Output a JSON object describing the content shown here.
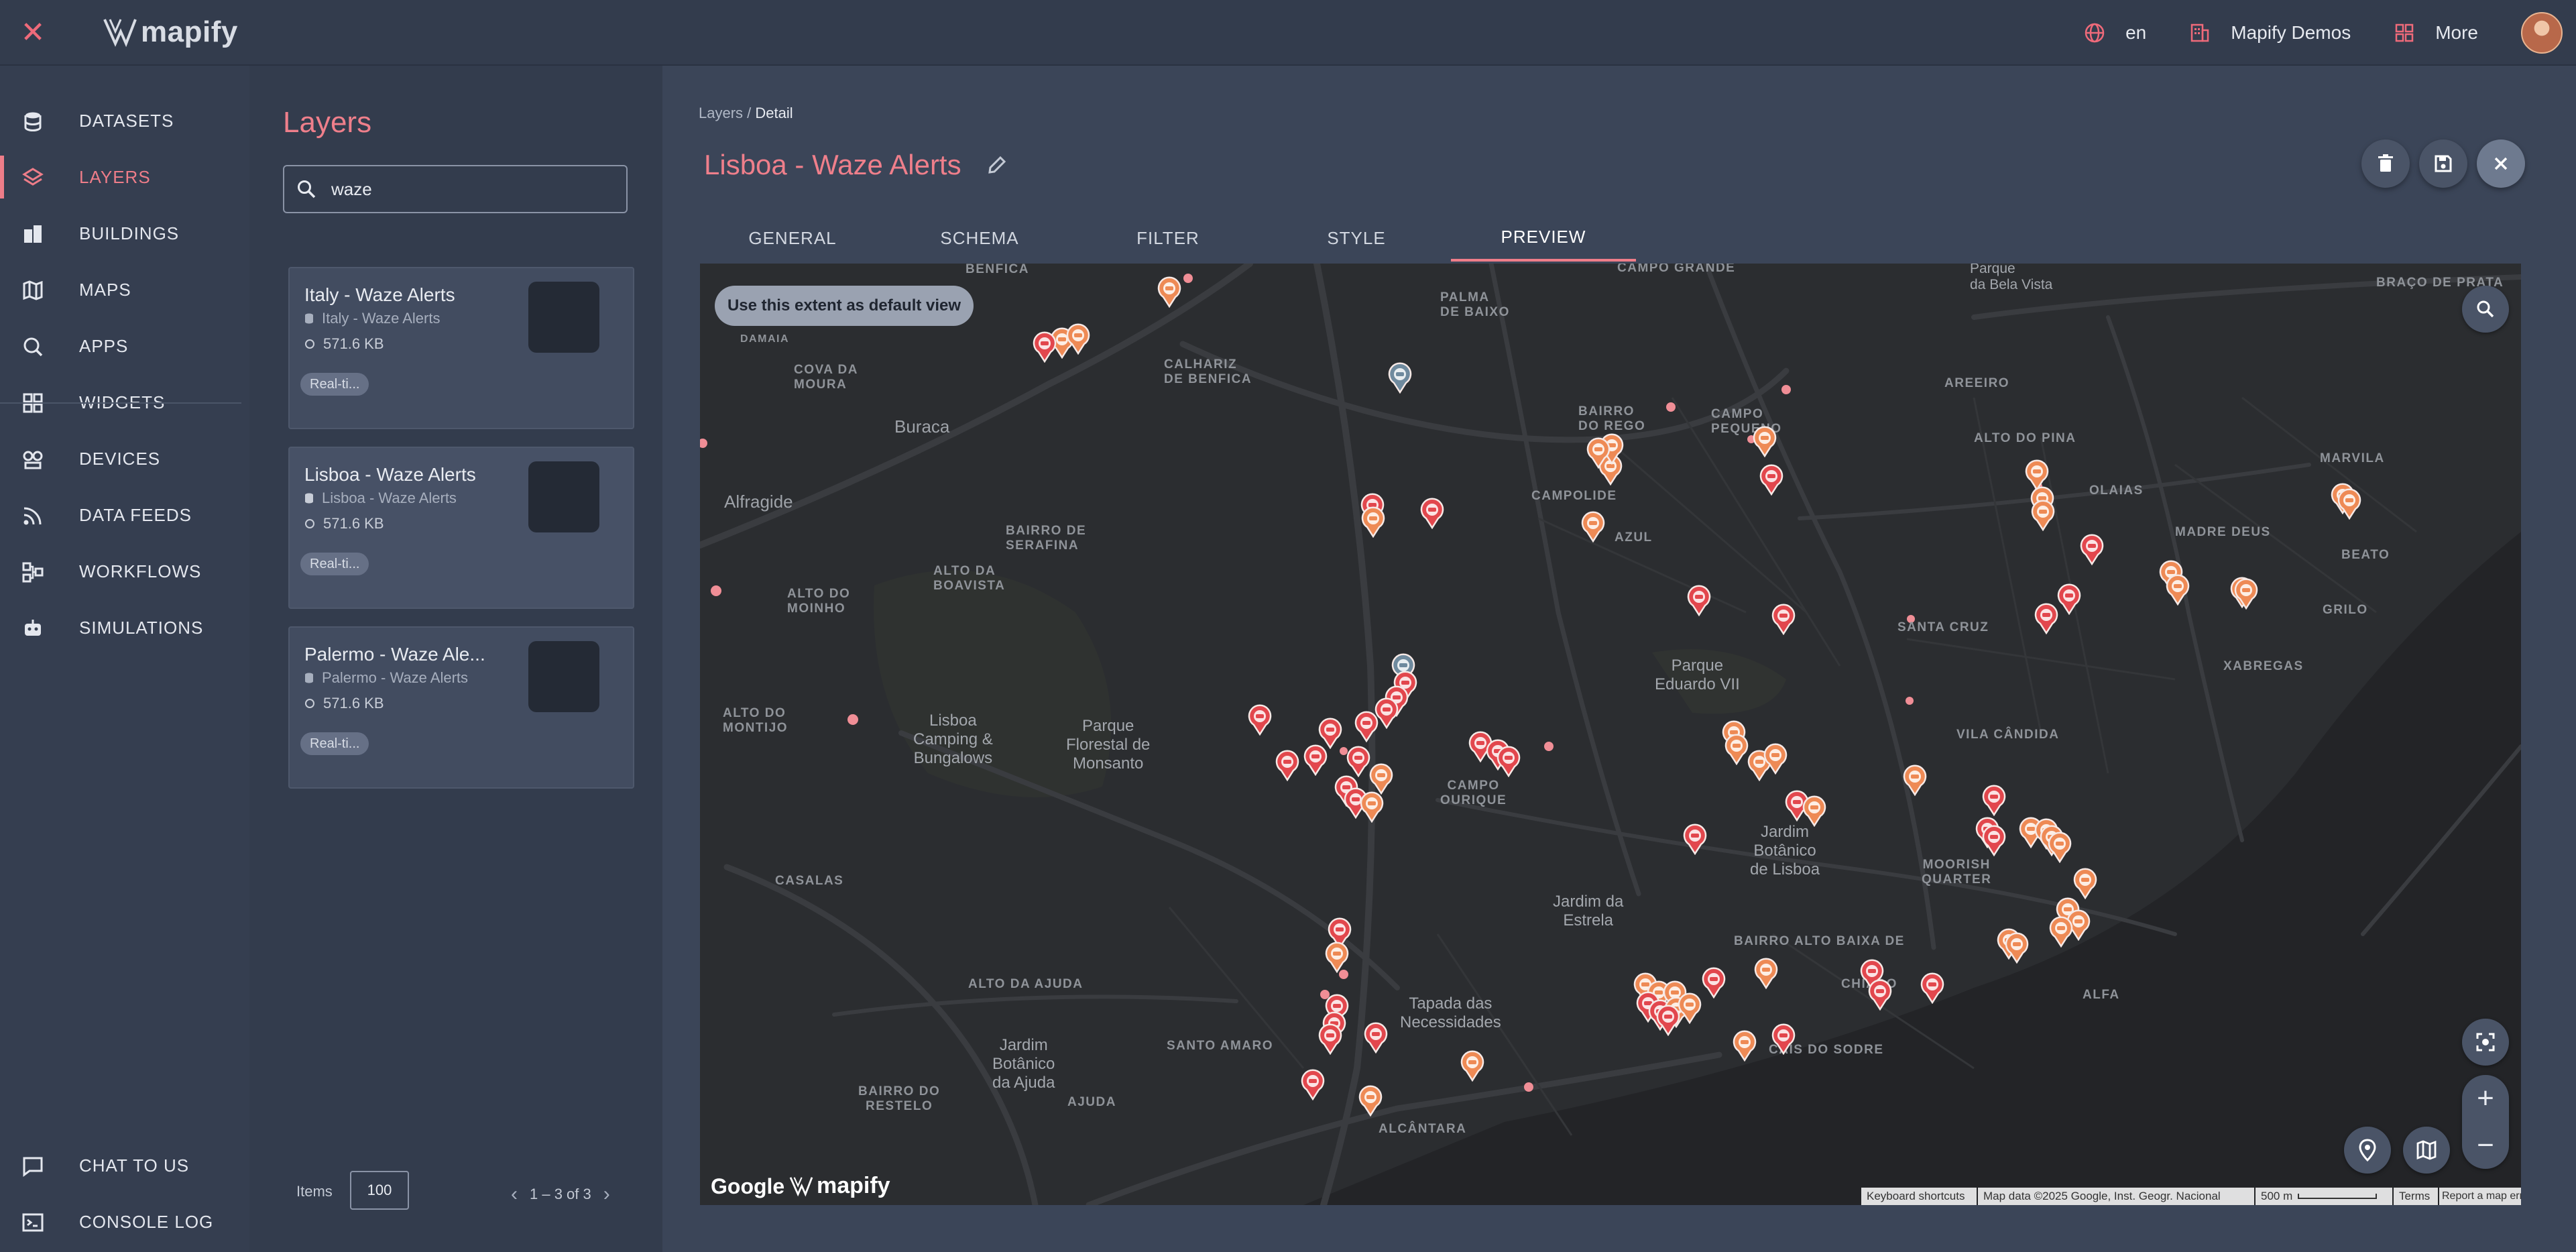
{
  "brand": {
    "name": "mapify"
  },
  "topbar": {
    "language": "en",
    "org": "Mapify Demos",
    "more": "More"
  },
  "nav": {
    "items": [
      {
        "label": "DATASETS",
        "icon": "database-icon"
      },
      {
        "label": "LAYERS",
        "icon": "layers-icon",
        "active": true
      },
      {
        "label": "BUILDINGS",
        "icon": "buildings-icon"
      },
      {
        "label": "MAPS",
        "icon": "map-icon"
      },
      {
        "label": "APPS",
        "icon": "apps-search-icon"
      },
      {
        "label": "WIDGETS",
        "icon": "widgets-icon"
      },
      {
        "label": "DEVICES",
        "icon": "devices-icon"
      },
      {
        "label": "DATA FEEDS",
        "icon": "rss-feed-icon"
      },
      {
        "label": "WORKFLOWS",
        "icon": "workflow-icon"
      },
      {
        "label": "SIMULATIONS",
        "icon": "robot-icon"
      }
    ],
    "bottom": [
      {
        "label": "CHAT TO US",
        "icon": "chat-icon"
      },
      {
        "label": "CONSOLE LOG",
        "icon": "console-icon"
      }
    ]
  },
  "layers": {
    "title": "Layers",
    "search_value": "waze",
    "cards": [
      {
        "title": "Italy - Waze Alerts",
        "dataset": "Italy - Waze Alerts",
        "size": "571.6 KB",
        "badge": "Real-ti..."
      },
      {
        "title": "Lisboa - Waze Alerts",
        "dataset": "Lisboa - Waze Alerts",
        "size": "571.6 KB",
        "badge": "Real-ti..."
      },
      {
        "title": "Palermo - Waze Ale...",
        "dataset": "Palermo - Waze Alerts",
        "size": "571.6 KB",
        "badge": "Real-ti..."
      }
    ],
    "items_label": "Items",
    "items_value": "100",
    "pager": "1 – 3 of 3"
  },
  "detail": {
    "breadcrumb_root": "Layers",
    "breadcrumb_sep": " / ",
    "breadcrumb_current": "Detail",
    "title": "Lisboa - Waze Alerts",
    "tabs": [
      "GENERAL",
      "SCHEMA",
      "FILTER",
      "STYLE",
      "PREVIEW"
    ],
    "active_tab": "PREVIEW"
  },
  "map": {
    "extent_button": "Use this extent as default view",
    "google": "Google",
    "brand": "mapify",
    "attribution": {
      "shortcuts": "Keyboard shortcuts",
      "data": "Map data ©2025 Google, Inst. Geogr. Nacional",
      "scale": "500 m",
      "terms": "Terms",
      "report": "Report a map error"
    },
    "labels": {
      "benfica": "BENFICA",
      "damaia": "DAMAIA",
      "cova_da_moura": "COVA DA\nMOURA",
      "calhariz": "CALHARIZ\nDE BENFICA",
      "buraca": "Buraca",
      "alfragide": "Alfragide",
      "palma": "PALMA\nDE BAIXO",
      "campo_grande": "CAMPO GRANDE",
      "parque_bela_vista": "Parque\nda Bela Vista",
      "braco_de_prata": "BRAÇO DE PRATA",
      "bairro_do_rego": "BAIRRO\nDO REGO",
      "campo_pequeno": "CAMPO\nPEQUENO",
      "areeiro": "AREEIRO",
      "alto_do_pina": "ALTO DO PINA",
      "marvila": "MARVILA",
      "olaias": "OLAIAS",
      "campolide": "CAMPOLIDE",
      "azul": "AZUL",
      "madre_deus": "MADRE DEUS",
      "beato": "BEATO",
      "bairro_de_serafina": "BAIRRO DE\nSERAFINA",
      "alto_da_boavista": "ALTO DA\nBOAVISTA",
      "alto_do_moinho": "ALTO DO\nMOINHO",
      "santa_cruz": "SANTA CRUZ",
      "grilo": "GRILO",
      "xabregas": "XABREGAS",
      "parque_eduardo": "Parque\nEduardo VII",
      "alto_do_montijo": "ALTO DO\nMONTIJO",
      "lisboa_camping": "Lisboa\nCamping &\nBungalows",
      "parque_monsanto": "Parque\nFlorestal de\nMonsanto",
      "campo_ourique": "CAMPO\nOURIQUE",
      "vila_candida": "VILA CÂNDIDA",
      "jardim_botanico_lisboa": "Jardim\nBotânico\nde Lisboa",
      "moorish_quarter": "MOORISH\nQUARTER",
      "casalas": "CASALAS",
      "jardim_estrela": "Jardim da\nEstrela",
      "bairro_alto": "BAIRRO ALTO BAIXA DE",
      "chiado": "CHIADO",
      "alfa": "ALFA",
      "alto_da_ajuda": "ALTO DA AJUDA",
      "tapada": "Tapada das\nNecessidades",
      "santo_amaro": "SANTO AMARO",
      "jardim_botanico_ajuda": "Jardim\nBotânico\nda Ajuda",
      "cais_sodre": "CAIS DO SODRE",
      "bairro_restelo": "BAIRRO DO\nRESTELO",
      "ajuda": "AJUDA",
      "alcantara": "ALCÂNTARA"
    }
  },
  "colors": {
    "accent": "#ee7d89",
    "marker_red": "#e2474d",
    "marker_orange": "#ee8a55",
    "map_bg": "#2b2d30"
  }
}
